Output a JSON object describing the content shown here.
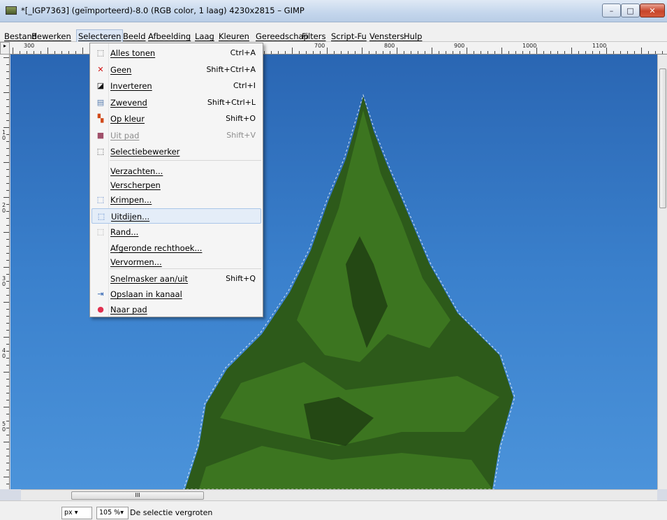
{
  "window": {
    "title": "*[_IGP7363] (geïmporteerd)-8.0 (RGB color, 1 laag) 4230x2815 – GIMP",
    "minimize": "–",
    "maximize": "□",
    "close": "✕"
  },
  "menubar": [
    "Bestand",
    "Bewerken",
    "Selecteren",
    "Beeld",
    "Afbeelding",
    "Laag",
    "Kleuren",
    "Gereedschap",
    "Filters",
    "Script-Fu",
    "Vensters",
    "Hulp"
  ],
  "menubar_active": "Selecteren",
  "ruler": {
    "h_labels": [
      "300",
      "700",
      "800",
      "900",
      "1000",
      "1100"
    ],
    "v_labels": [
      "1\n0",
      "2\n0",
      "3\n0",
      "4\n0",
      "5\n0"
    ]
  },
  "select_menu": {
    "items": [
      {
        "label": "Alles tonen",
        "shortcut": "Ctrl+A",
        "icon": "dotted-rect-icon"
      },
      {
        "label": "Geen",
        "shortcut": "Shift+Ctrl+A",
        "icon": "red-x-icon"
      },
      {
        "label": "Inverteren",
        "shortcut": "Ctrl+I",
        "icon": "invert-icon"
      },
      {
        "label": "Zwevend",
        "shortcut": "Shift+Ctrl+L",
        "icon": "float-icon"
      },
      {
        "label": "Op kleur",
        "shortcut": "Shift+O",
        "icon": "color-select-icon"
      },
      {
        "label": "Uit pad",
        "shortcut": "Shift+V",
        "icon": "from-path-icon",
        "disabled": true
      },
      {
        "label": "Selectiebewerker",
        "shortcut": "",
        "icon": "selection-editor-icon"
      },
      {
        "label": "Verzachten...",
        "shortcut": "",
        "icon": ""
      },
      {
        "label": "Verscherpen",
        "shortcut": "",
        "icon": ""
      },
      {
        "label": "Krimpen...",
        "shortcut": "",
        "icon": "shrink-icon"
      },
      {
        "label": "Uitdijen...",
        "shortcut": "",
        "icon": "grow-icon",
        "highlight": true
      },
      {
        "label": "Rand...",
        "shortcut": "",
        "icon": "border-icon"
      },
      {
        "label": "Afgeronde rechthoek...",
        "shortcut": "",
        "icon": ""
      },
      {
        "label": "Vervormen...",
        "shortcut": "",
        "icon": ""
      },
      {
        "label": "Snelmasker aan/uit",
        "shortcut": "Shift+Q",
        "icon": ""
      },
      {
        "label": "Opslaan in kanaal",
        "shortcut": "",
        "icon": "save-channel-icon"
      },
      {
        "label": "Naar pad",
        "shortcut": "",
        "icon": "to-path-icon"
      }
    ]
  },
  "statusbar": {
    "unit": "px",
    "zoom": "105 %",
    "message": "De selectie vergroten"
  },
  "hscroll_label": "III"
}
